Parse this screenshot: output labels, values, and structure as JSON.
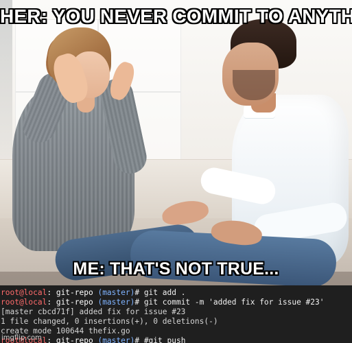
{
  "meme": {
    "top_caption": "HER: YOU NEVER COMMIT TO ANYTHING",
    "bottom_caption": "ME: THAT'S NOT TRUE..."
  },
  "terminal": {
    "lines": [
      {
        "prompt_user_host": "root@local",
        "prompt_repo": ": git-repo ",
        "prompt_branch": "(master)",
        "command": "# git add ."
      },
      {
        "prompt_user_host": "root@local",
        "prompt_repo": ": git-repo ",
        "prompt_branch": "(master)",
        "command": "# git commit -m 'added fix for issue #23'"
      },
      {
        "output": "[master cbcd71f] added fix for issue #23"
      },
      {
        "output": " 1 file changed, 0 insertions(+), 0 deletions(-)"
      },
      {
        "output": " create mode 100644 thefix.go"
      },
      {
        "prompt_user_host": "root@local",
        "prompt_repo": ": git-repo ",
        "prompt_branch": "(master)",
        "command": "# #git push"
      }
    ]
  },
  "watermark": "imgflip.com"
}
